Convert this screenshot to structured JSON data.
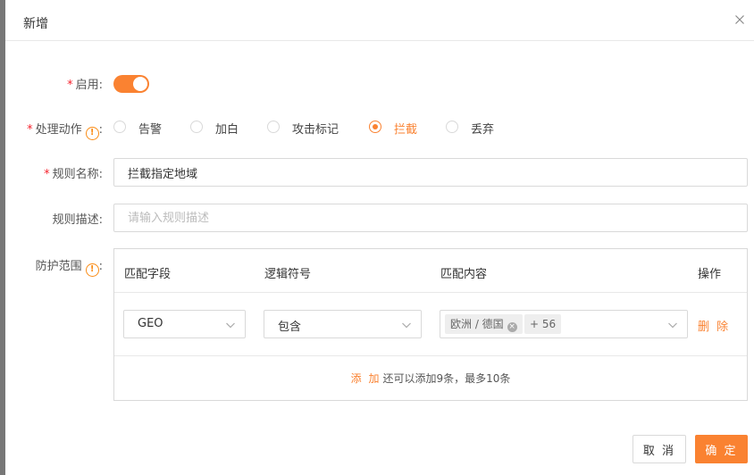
{
  "modal": {
    "title": "新增",
    "close_icon": "close-icon"
  },
  "form": {
    "enable": {
      "required_mark": "*",
      "label": "启用:",
      "value": true,
      "color": "#fa8231"
    },
    "action": {
      "required_mark": "*",
      "label": "处理动作",
      "info_icon": "!",
      "suffix": ":",
      "options": [
        {
          "label": "告警",
          "selected": false
        },
        {
          "label": "加白",
          "selected": false
        },
        {
          "label": "攻击标记",
          "selected": false
        },
        {
          "label": "拦截",
          "selected": true
        },
        {
          "label": "丢弃",
          "selected": false
        }
      ]
    },
    "rule_name": {
      "required_mark": "*",
      "label": "规则名称:",
      "value": "拦截指定地域"
    },
    "rule_desc": {
      "label": "规则描述:",
      "placeholder": "请输入规则描述",
      "value": ""
    },
    "scope": {
      "label": "防护范围",
      "info_icon": "!",
      "suffix": ":",
      "columns": [
        "匹配字段",
        "逻辑符号",
        "匹配内容",
        "操作"
      ],
      "rows": [
        {
          "field": "GEO",
          "operator": "包含",
          "content_tags": [
            "欧洲 / 德国"
          ],
          "more_tag": "+ 56",
          "delete_label": "删 除"
        }
      ],
      "add_label": "添 加",
      "add_hint": "还可以添加9条，最多10条"
    }
  },
  "footer": {
    "cancel_label": "取 消",
    "ok_label": "确 定"
  }
}
